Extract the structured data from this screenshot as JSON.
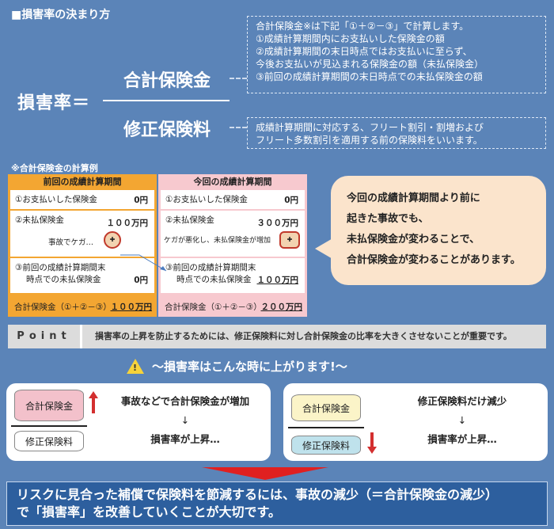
{
  "section_title": "■損害率の決まり方",
  "formula": {
    "label": "損害率＝",
    "numerator": "合計保険金",
    "denominator": "修正保険料"
  },
  "numerator_note": [
    "合計保険金※は下記「①＋②－③」で計算します。",
    "①成績計算期間内にお支払いした保険金の額",
    "②成績計算期間の末日時点ではお支払いに至らず、",
    "今後お支払いが見込まれる保険金の額（未払保険金）",
    "③前回の成績計算期間の末日時点での未払保険金の額"
  ],
  "denominator_note": [
    "成績計算期間に対応する、フリート割引・割増および",
    "フリート多数割引を適用する前の保険料をいいます。"
  ],
  "calc_title": "※合計保険金の計算例",
  "calc": {
    "prev": {
      "header": "前回の成績計算期間",
      "r1_label": "①お支払いした保険金",
      "r1_amount": "0円",
      "r2_label": "②未払保険金",
      "r2_amount": "１００万円",
      "r2_sub": "事故でケガ…",
      "r3_label_1": "③前回の成績計算期間末",
      "r3_label_2": "時点での未払保険金",
      "r3_amount": "0円",
      "total_label": "合計保険金（①＋②－③）",
      "total_amount": "１００万円"
    },
    "curr": {
      "header": "今回の成績計算期間",
      "r1_label": "①お支払いした保険金",
      "r1_amount": "0円",
      "r2_label": "②未払保険金",
      "r2_amount": "３００万円",
      "r2_sub": "ケガが悪化し、未払保険金が増加",
      "r3_label_1": "③前回の成績計算期間末",
      "r3_label_2": "時点での未払保険金",
      "r3_amount": "１００万円",
      "total_label": "合計保険金（①＋②－③）",
      "total_amount": "２００万円"
    }
  },
  "bubble_lines": [
    "今回の成績計算期間より前に",
    "起きた事故でも、",
    "未払保険金が変わることで、",
    "合計保険金が変わることがあります。"
  ],
  "point": {
    "label": "Point",
    "text": "損害率の上昇を防止するためには、修正保険料に対し合計保険金の比率を大きくさせないことが重要です。"
  },
  "warning_title": "～損害率はこんな時に上がります!～",
  "case_left": {
    "cyl_top": "合計保険金",
    "cyl_bottom": "修正保険料",
    "line1": "事故などで合計保険金が増加",
    "arrow": "↓",
    "line2": "損害率が上昇…"
  },
  "case_right": {
    "cyl_top": "合計保険金",
    "cyl_bottom": "修正保険料",
    "line1": "修正保険料だけ減少",
    "arrow": "↓",
    "line2": "損害率が上昇…"
  },
  "conclusion": [
    "リスクに見合った補償で保険料を節減するには、事故の減少（＝合計保険金の減少）",
    "で「損害率」を改善していくことが大切です。"
  ],
  "colors": {
    "background": "#5b84b8",
    "prev_column": "#f3a632",
    "curr_column": "#f7c9cf",
    "bubble": "#fbe4cc",
    "arrow_red": "#d32f2f",
    "conclusion_bg": "#2d5f9e"
  }
}
